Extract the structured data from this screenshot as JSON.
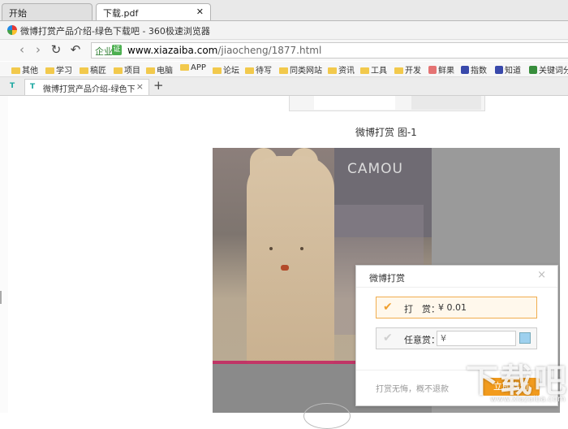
{
  "outer_tabs": [
    {
      "label": "开始",
      "active": false
    },
    {
      "label": "下载.pdf",
      "active": true
    }
  ],
  "window": {
    "title": "微博打赏产品介绍-绿色下载吧 - 360极速浏览器"
  },
  "address": {
    "badge": "企业",
    "shield": "证",
    "host": "www.xiazaiba.com",
    "path": "/jiaocheng/1877.html"
  },
  "bookmarks": [
    "其他",
    "学习",
    "稿匠",
    "项目",
    "电脑",
    "APP",
    "论坛",
    "待写",
    "同类网站",
    "资讯",
    "工具",
    "开发",
    "鲜果",
    "指数",
    "知道",
    "关键词分"
  ],
  "browser_tab": {
    "label": "微博打赏产品介绍-绿色下载吧",
    "icon": "T"
  },
  "content": {
    "caption": "微博打赏 图-1",
    "shirt_text": "CAMOU"
  },
  "dialog": {
    "title": "微博打赏",
    "option1_label": "打　赏：",
    "option1_value": "¥ 0.01",
    "option2_label": "任意赏：",
    "option2_placeholder": "¥",
    "note": "打赏无悔，概不退款",
    "pay_label": "立即支付"
  },
  "watermark": {
    "big": "下载吧",
    "small": "www.xiazaiba.com"
  },
  "colors": {
    "accent": "#f29b1d",
    "selected_border": "#f0ad4e",
    "pink": "#c2185b"
  }
}
